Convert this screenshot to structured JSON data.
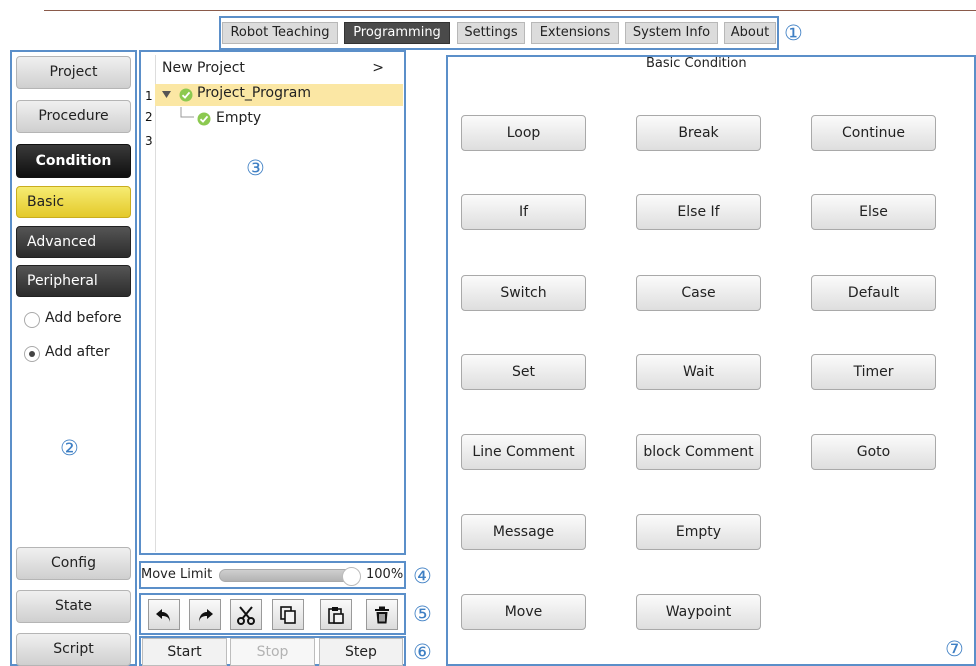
{
  "tabs": {
    "robot_teaching": "Robot Teaching",
    "programming": "Programming",
    "settings": "Settings",
    "extensions": "Extensions",
    "system_info": "System Info",
    "about": "About"
  },
  "callouts": {
    "c1": "①",
    "c2": "②",
    "c3": "③",
    "c4": "④",
    "c5": "⑤",
    "c6": "⑥",
    "c7": "⑦"
  },
  "sidebar": {
    "project": "Project",
    "procedure": "Procedure",
    "condition": "Condition",
    "basic": "Basic",
    "advanced": "Advanced",
    "peripheral": "Peripheral",
    "add_before": "Add before",
    "add_after": "Add after",
    "insert_mode": "Add after",
    "config": "Config",
    "state": "State",
    "script": "Script"
  },
  "tree": {
    "header": "New Project",
    "header_arrow": ">",
    "line_numbers": [
      "1",
      "2",
      "3"
    ],
    "root": "Project_Program",
    "child": "Empty"
  },
  "move_limit": {
    "label": "Move Limit",
    "value_text": "100%",
    "value": 100
  },
  "toolbar": {
    "icons": [
      "undo-icon",
      "redo-icon",
      "cut-icon",
      "copy-icon",
      "paste-icon",
      "delete-icon"
    ]
  },
  "controls": {
    "start": "Start",
    "stop": "Stop",
    "step": "Step"
  },
  "panel": {
    "title": "Basic Condition",
    "buttons": {
      "loop": "Loop",
      "break": "Break",
      "continue": "Continue",
      "if": "If",
      "else_if": "Else If",
      "else": "Else",
      "switch": "Switch",
      "case": "Case",
      "default": "Default",
      "set": "Set",
      "wait": "Wait",
      "timer": "Timer",
      "line_comment": "Line Comment",
      "block_comment": "block Comment",
      "goto": "Goto",
      "message": "Message",
      "empty": "Empty",
      "move": "Move",
      "waypoint": "Waypoint"
    }
  },
  "colors": {
    "callout": "#5b8fc9",
    "active_tab": "#4a4a4a",
    "selection": "#fbe7a4",
    "check": "#7cc142",
    "basic_button": "#f0df4a"
  }
}
